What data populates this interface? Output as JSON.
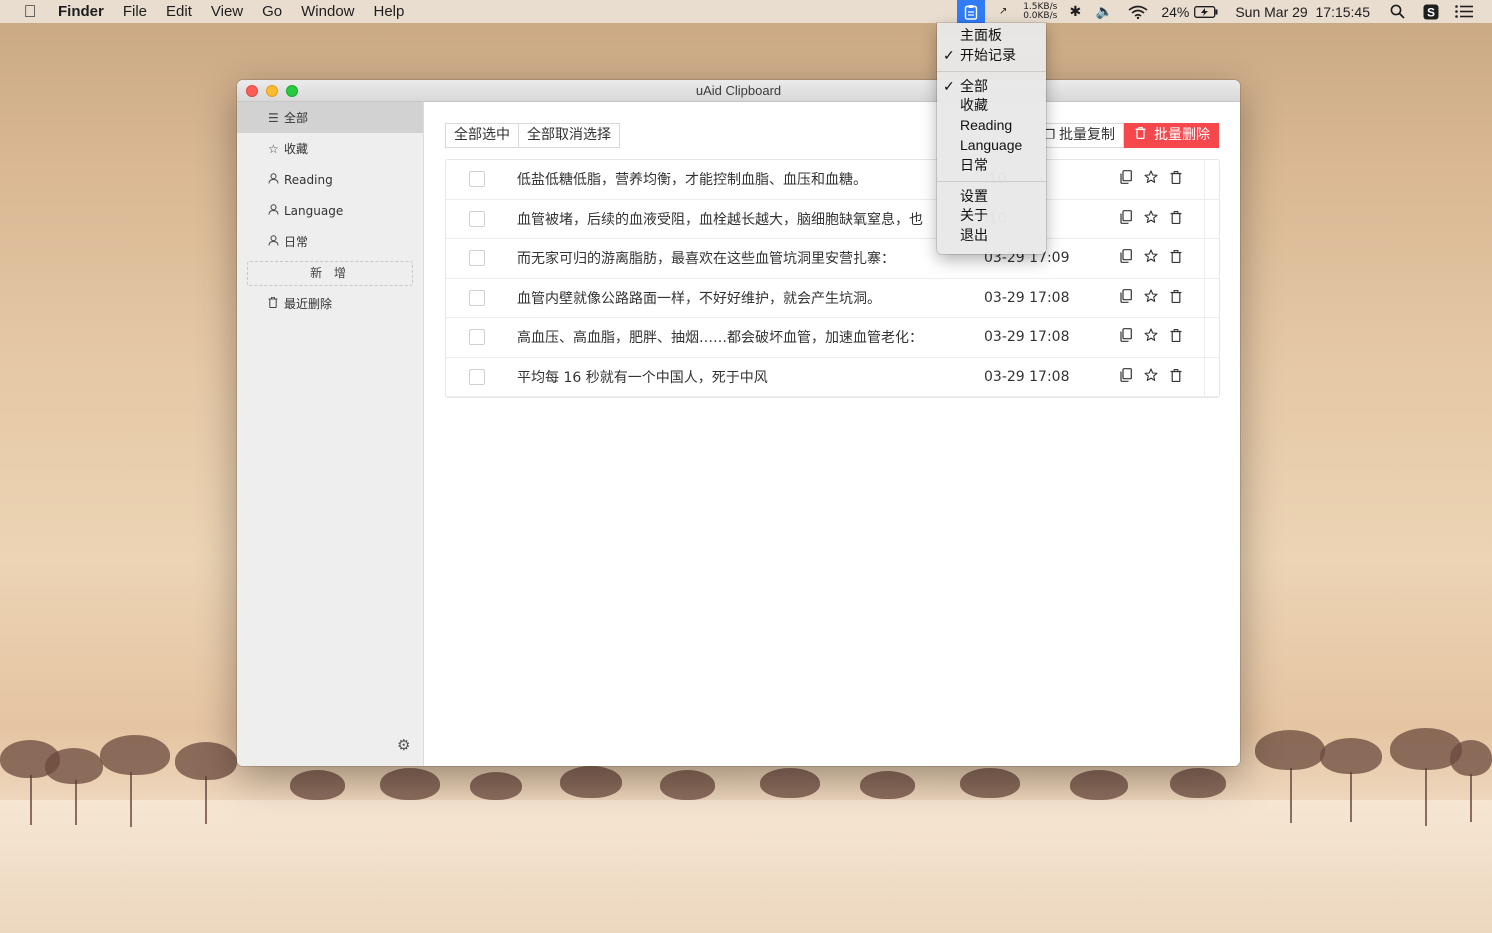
{
  "menubar": {
    "app_name": "Finder",
    "menus": [
      "File",
      "Edit",
      "View",
      "Go",
      "Window",
      "Help"
    ],
    "net_up": "1.5KB/s",
    "net_down": "0.0KB/s",
    "battery": "24%",
    "datetime": "Sun Mar 29  17:15:45"
  },
  "window": {
    "title": "uAid Clipboard"
  },
  "sidebar": {
    "items": [
      {
        "label": "全部",
        "icon": "list-icon"
      },
      {
        "label": "收藏",
        "icon": "star-icon"
      },
      {
        "label": "Reading",
        "icon": "user-icon"
      },
      {
        "label": "Language",
        "icon": "user-icon"
      },
      {
        "label": "日常",
        "icon": "user-icon"
      }
    ],
    "new_label": "新 增",
    "trash_label": "最近删除"
  },
  "toolbar": {
    "select_all": "全部选中",
    "deselect_all": "全部取消选择",
    "batch_copy": "批量复制",
    "batch_delete": "批量删除"
  },
  "rows": [
    {
      "text": "低盐低糖低脂，营养均衡，才能控制血脂、血压和血糖。",
      "time": ":10"
    },
    {
      "text": "血管被堵，后续的血液受阻，血栓越长越大，脑细胞缺氧窒息，也",
      "time": ":10"
    },
    {
      "text": "而无家可归的游离脂肪，最喜欢在这些血管坑洞里安营扎寨：",
      "time": "03-29 17:09"
    },
    {
      "text": "血管内壁就像公路路面一样，不好好维护，就会产生坑洞。",
      "time": "03-29 17:08"
    },
    {
      "text": "高血压、高血脂，肥胖、抽烟……都会破坏血管，加速血管老化：",
      "time": "03-29 17:08"
    },
    {
      "text": "平均每 16 秒就有一个中国人，死于中风",
      "time": "03-29 17:08"
    }
  ],
  "dropdown": {
    "group1": [
      {
        "label": "主面板",
        "checked": false
      },
      {
        "label": "开始记录",
        "checked": true
      }
    ],
    "group2": [
      {
        "label": "全部",
        "checked": true
      },
      {
        "label": "收藏",
        "checked": false
      },
      {
        "label": "Reading",
        "checked": false
      },
      {
        "label": "Language",
        "checked": false
      },
      {
        "label": "日常",
        "checked": false
      }
    ],
    "group3": [
      {
        "label": "设置",
        "checked": false
      },
      {
        "label": "关于",
        "checked": false
      },
      {
        "label": "退出",
        "checked": false
      }
    ],
    "check_mark": "✓"
  },
  "colors": {
    "accent_blue": "#2f7cf6",
    "danger_red": "#f5474c"
  }
}
